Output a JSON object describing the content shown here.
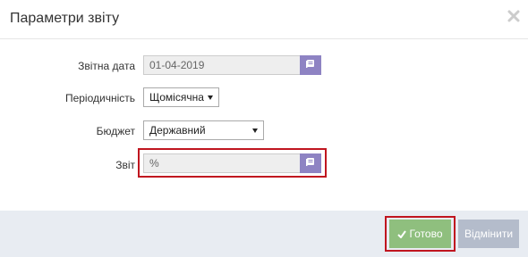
{
  "dialog": {
    "title": "Параметри звіту"
  },
  "form": {
    "report_date_label": "Звітна дата",
    "report_date_value": "01-04-2019",
    "periodicity_label": "Періодичність",
    "periodicity_value": "Щомісячна",
    "budget_label": "Бюджет",
    "budget_value": "Державний",
    "report_label": "Звіт",
    "report_value": "%"
  },
  "footer": {
    "ok_label": "Готово",
    "cancel_label": "Відмінити"
  },
  "colors": {
    "addon": "#8e83c3",
    "highlight": "#c0151f",
    "ok": "#8fbf7e",
    "cancel": "#b4bccb",
    "footer_bg": "#e8ecf2"
  }
}
